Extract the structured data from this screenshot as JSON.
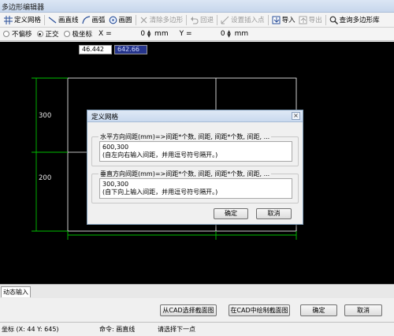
{
  "window": {
    "title": "多边形编辑器"
  },
  "toolbar": {
    "items": [
      {
        "label": "定义网格",
        "icon": "grid-icon",
        "enabled": true
      },
      {
        "label": "画直线",
        "icon": "line-icon",
        "enabled": true
      },
      {
        "label": "画弧",
        "icon": "arc-icon",
        "enabled": true
      },
      {
        "label": "画圆",
        "icon": "circle-icon",
        "enabled": true
      },
      {
        "label": "清除多边形",
        "icon": "clear-icon",
        "enabled": false
      },
      {
        "label": "回退",
        "icon": "undo-icon",
        "enabled": false
      },
      {
        "label": "设置插入点",
        "icon": "insert-point-icon",
        "enabled": false
      },
      {
        "label": "导入",
        "icon": "import-icon",
        "enabled": true
      },
      {
        "label": "导出",
        "icon": "export-icon",
        "enabled": false
      },
      {
        "label": "查询多边形库",
        "icon": "search-icon",
        "enabled": true
      }
    ]
  },
  "coords": {
    "modes": [
      {
        "label": "不偏移",
        "checked": false
      },
      {
        "label": "正交",
        "checked": true
      },
      {
        "label": "极坐标",
        "checked": false
      }
    ],
    "x_label": "X =",
    "x_value": "0",
    "x_unit": "mm",
    "y_label": "Y =",
    "y_value": "0",
    "y_unit": "mm"
  },
  "canvas": {
    "input_x": "46.442",
    "input_y": "642.66",
    "dim_labels": [
      "300",
      "200"
    ]
  },
  "dialog": {
    "title": "定义网格",
    "close": "×",
    "horizontal": {
      "label": "水平方向间距(mm)=>间距*个数, 间距, 间距*个数, 间距, ...",
      "value_line1": "600,300",
      "value_line2": "(自左向右输入间距，并用逗号符号隔开。)"
    },
    "vertical": {
      "label": "垂直方向间距(mm)=>间距*个数, 间距, 间距*个数, 间距, ...",
      "value_line1": "300,300",
      "value_line2": "(自下向上输入间距，并用逗号符号隔开。)"
    },
    "ok_label": "确定",
    "cancel_label": "取消"
  },
  "tabs": {
    "dynamic_input": "动态输入"
  },
  "bottom": {
    "select_from_cad": "从CAD选择截面图",
    "draw_in_cad": "在CAD中绘制截面图",
    "confirm": "确定",
    "cancel": "取消"
  },
  "status": {
    "coords": "坐标 (X: 44 Y: 645)",
    "command": "命令: 画直线",
    "prompt": "请选择下一点"
  },
  "colors": {
    "canvas_bg": "#000000",
    "grid_line": "#ffffff",
    "dimension_line": "#00c000",
    "active_input_bg": "#26358c"
  }
}
